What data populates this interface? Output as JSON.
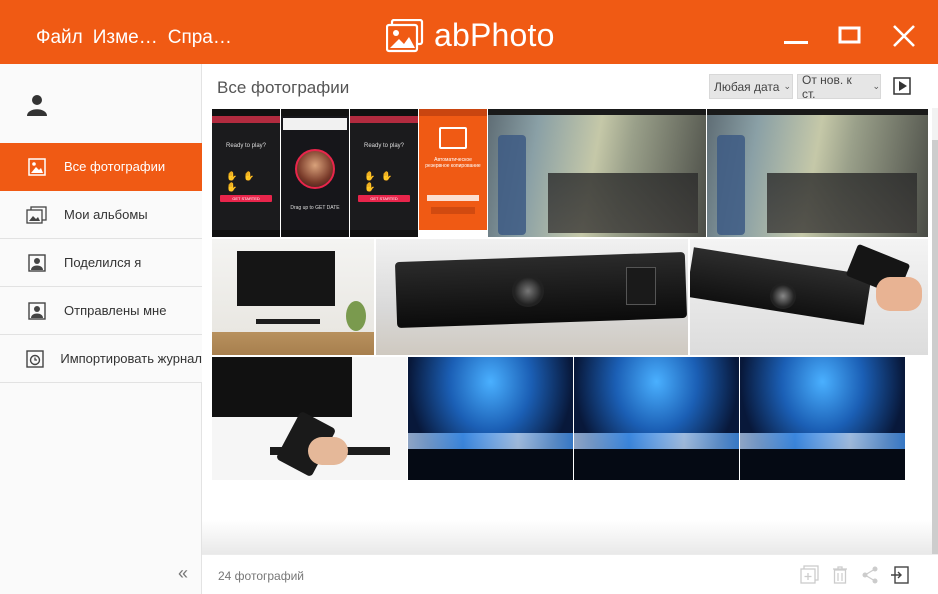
{
  "app": {
    "title": "abPhoto",
    "menu": [
      "Файл",
      "Изме…",
      "Спра…"
    ],
    "accent_color": "#f05a14"
  },
  "window_controls": {
    "icons": [
      "minimize-icon",
      "maximize-icon",
      "close-icon"
    ]
  },
  "sidebar": {
    "user_icon": "user-icon",
    "items": [
      {
        "label": "Все фотографии",
        "icon": "photo-icon",
        "active": true
      },
      {
        "label": "Мои альбомы",
        "icon": "albums-icon",
        "active": false
      },
      {
        "label": "Поделился я",
        "icon": "shared-by-me-icon",
        "active": false
      },
      {
        "label": "Отправлены мне",
        "icon": "shared-with-me-icon",
        "active": false
      },
      {
        "label": "Импортировать журнал",
        "icon": "import-history-icon",
        "active": false
      }
    ],
    "collapse_label": "«"
  },
  "main": {
    "title": "Все фотографии",
    "date_filter": "Любая дата",
    "sort_order": "От нов. к ст.",
    "slideshow_icon": "slideshow-play-icon"
  },
  "gallery": {
    "rows": [
      {
        "photos": [
          {
            "subject": "phone screenshot: Ready to play?",
            "caption": "Ready to play?",
            "button": "GET STARTED"
          },
          {
            "subject": "phone screenshot: Snapchat swipe",
            "caption": "Drag up to GET DATE"
          },
          {
            "subject": "phone screenshot: Ready to play?",
            "caption": "Ready to play?",
            "button": "GET STARTED"
          },
          {
            "subject": "phone screenshot: auto backup",
            "caption": "Автоматическое резервное копирование"
          },
          {
            "subject": "metro carriage passengers"
          },
          {
            "subject": "metro carriage passengers"
          }
        ]
      },
      {
        "photos": [
          {
            "subject": "TV with soundbar on wall"
          },
          {
            "subject": "soundbar speaker closeup"
          },
          {
            "subject": "soundbar with phone in hand"
          }
        ]
      },
      {
        "photos": [
          {
            "subject": "hand holding phone near soundbar"
          },
          {
            "subject": "concert stage blue lights"
          },
          {
            "subject": "concert stage blue lights"
          },
          {
            "subject": "concert stage blue lights"
          }
        ]
      }
    ]
  },
  "footer": {
    "count": "24 фотографий",
    "tools": [
      "add-to-album-icon",
      "delete-icon",
      "share-icon",
      "export-icon"
    ]
  }
}
